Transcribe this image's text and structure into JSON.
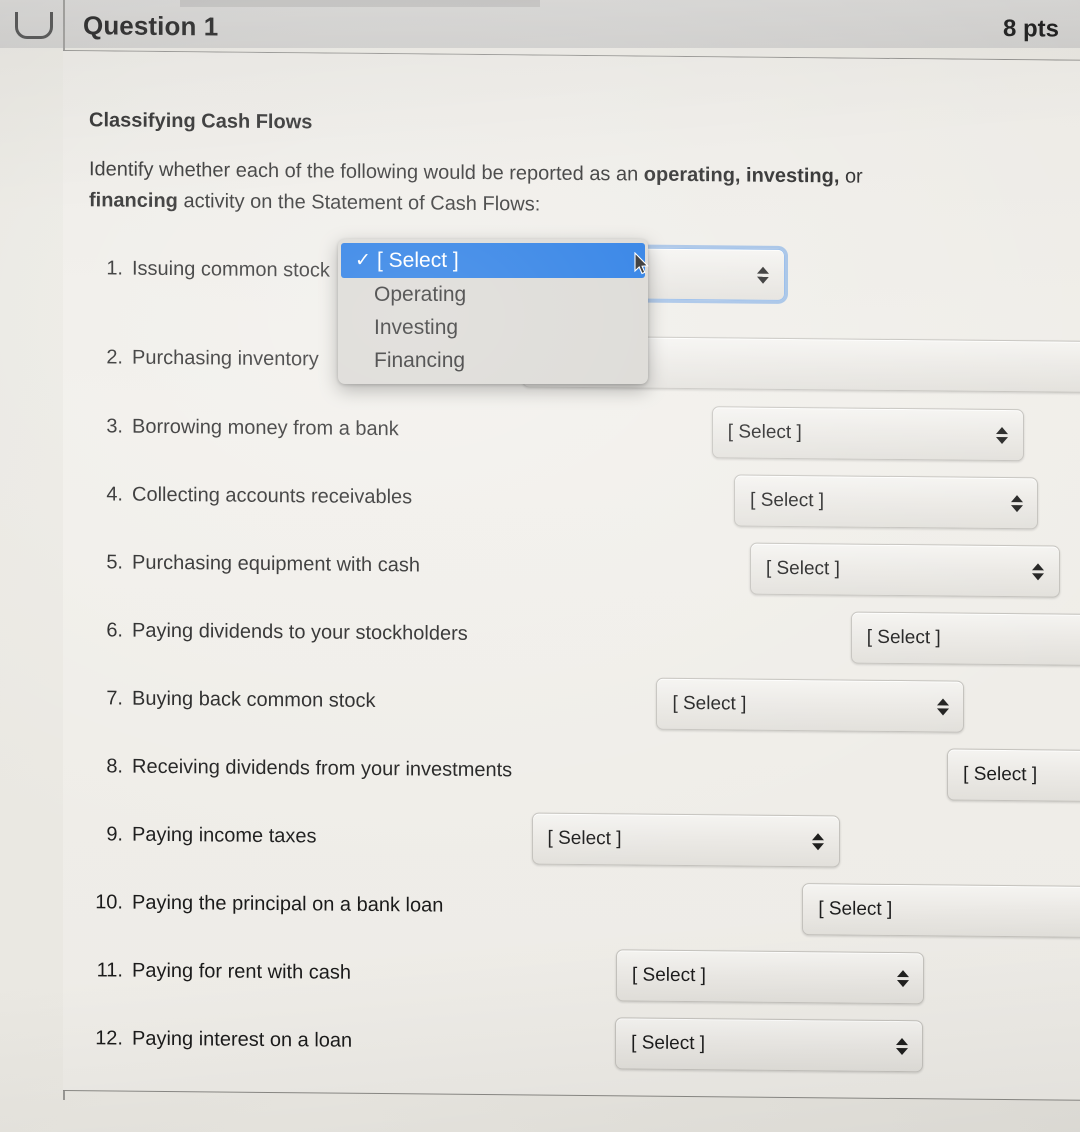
{
  "header": {
    "question_title": "Question 1",
    "points": "8 pts",
    "left_glyph_icon": "bracket-icon"
  },
  "content": {
    "section_heading": "Classifying Cash Flows",
    "instructions_parts": [
      {
        "text": "Identify whether each of the following would be reported as an ",
        "bold": false
      },
      {
        "text": "operating, investing, ",
        "bold": true
      },
      {
        "text": "or ",
        "bold": false
      },
      {
        "text": "financing",
        "bold": true
      },
      {
        "text": " activity on the Statement of Cash Flows:",
        "bold": false
      }
    ],
    "instructions_plain": "Identify whether each of the following would be reported as an operating, investing, or financing activity on the Statement of Cash Flows:"
  },
  "select_placeholder": "[ Select ]",
  "items": [
    {
      "num": "1.",
      "label": "Issuing common stock",
      "value": "[ Select ]",
      "open": true
    },
    {
      "num": "2.",
      "label": "Purchasing inventory",
      "value": "[ Select ]",
      "open": false
    },
    {
      "num": "3.",
      "label": "Borrowing money from a bank",
      "value": "[ Select ]",
      "open": false
    },
    {
      "num": "4.",
      "label": "Collecting accounts receivables",
      "value": "[ Select ]",
      "open": false
    },
    {
      "num": "5.",
      "label": "Purchasing equipment with cash",
      "value": "[ Select ]",
      "open": false
    },
    {
      "num": "6.",
      "label": "Paying dividends to your stockholders",
      "value": "[ Select ]",
      "open": false
    },
    {
      "num": "7.",
      "label": "Buying back common stock",
      "value": "[ Select ]",
      "open": false
    },
    {
      "num": "8.",
      "label": "Receiving dividends from your investments",
      "value": "[ Select ]",
      "open": false
    },
    {
      "num": "9.",
      "label": "Paying income taxes",
      "value": "[ Select ]",
      "open": false
    },
    {
      "num": "10.",
      "label": "Paying the principal on a bank loan",
      "value": "[ Select ]",
      "open": false
    },
    {
      "num": "11.",
      "label": "Paying for rent with cash",
      "value": "[ Select ]",
      "open": false
    },
    {
      "num": "12.",
      "label": "Paying interest on a loan",
      "value": "[ Select ]",
      "open": false
    }
  ],
  "dropdown": {
    "for_item": "1",
    "selected": "[ Select ]",
    "check_icon": "✓",
    "options": [
      {
        "label": "[ Select ]",
        "selected": true
      },
      {
        "label": "Operating",
        "selected": false
      },
      {
        "label": "Investing",
        "selected": false
      },
      {
        "label": "Financing",
        "selected": false
      }
    ]
  },
  "cursor": {
    "icon": "mouse-pointer-icon"
  },
  "colors": {
    "highlight_blue": "#0a6ae1",
    "focus_ring_blue": "#8ab4e8",
    "page_background": "#eceae5",
    "header_band": "#d3d2d0",
    "text": "#1b1b1b"
  }
}
